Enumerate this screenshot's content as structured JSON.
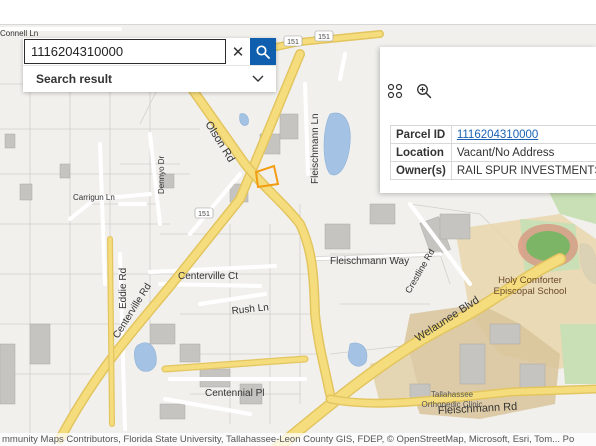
{
  "search": {
    "value": "1116204310000",
    "clear_label": "✕",
    "result_label": "Search result"
  },
  "popup": {
    "rows": [
      {
        "key": "Parcel ID",
        "value": "1116204310000"
      },
      {
        "key": "Location",
        "value": "Vacant/No Address"
      },
      {
        "key": "Owner(s)",
        "value": "RAIL SPUR INVESTMENTS L"
      }
    ]
  },
  "map_labels": {
    "olson_rd": "Olson Rd",
    "fleischmann_ln": "Fleischmann Ln",
    "fleischmann_way": "Fleischmann Way",
    "fleischmann_rd": "Fleischmann Rd",
    "welaunee_blvd": "Welaunee Blvd",
    "centerville_rd": "Centerville Rd",
    "centerville_ct": "Centerville Ct",
    "centennial_pl": "Centennial Pl",
    "eddie_rd": "Eddie Rd",
    "rush_ln": "Rush Ln",
    "crestline_rd": "Crestline Rd",
    "dennyo_dr": "Dennyo Dr",
    "carriage_ln": "Carrigun Ln",
    "connell_ln": "Connell Ln",
    "holy_comforter_1": "Holy Comforter",
    "holy_comforter_2": "Episcopal School",
    "tallahassee_ortho_1": "Tallahassee",
    "tallahassee_ortho_2": "Orthopedic Clinic",
    "shield_151": "151",
    "shield_151b": "151",
    "shield_151c": "151"
  },
  "attribution": "mmunity Maps Contributors, Florida State University, Tallahassee-Leon County GIS, FDEP, © OpenStreetMap, Microsoft, Esri, Tom...   Po",
  "colors": {
    "major_road": "#f5dd7d",
    "road_casing": "#e3c560",
    "minor_road": "#ffffff",
    "water": "#a4c3e4",
    "park": "#c9dfb5",
    "selected_parcel": "#f39c12",
    "search_button": "#0f5fae"
  }
}
